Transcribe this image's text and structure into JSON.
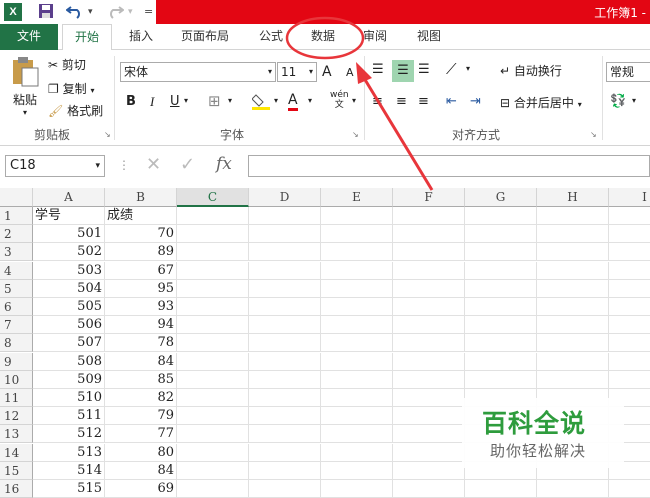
{
  "titlebar": {
    "app_icon": "X",
    "window_title": "工作簿1 -"
  },
  "tabs": [
    {
      "label": "文件"
    },
    {
      "label": "开始"
    },
    {
      "label": "插入"
    },
    {
      "label": "页面布局"
    },
    {
      "label": "公式"
    },
    {
      "label": "数据"
    },
    {
      "label": "审阅"
    },
    {
      "label": "视图"
    }
  ],
  "ribbon": {
    "clipboard": {
      "paste": "粘贴",
      "cut": "剪切",
      "copy": "复制",
      "format_painter": "格式刷",
      "group_label": "剪贴板"
    },
    "font": {
      "font_name": "宋体",
      "font_size": "11",
      "grow": "A",
      "shrink": "A",
      "bold": "B",
      "italic": "I",
      "underline": "U",
      "font_color_glyph": "A",
      "phonetic": "wén",
      "phonetic_sub": "文",
      "group_label": "字体"
    },
    "alignment": {
      "wrap_text": "自动换行",
      "merge_center": "合并后居中",
      "group_label": "对齐方式"
    },
    "number": {
      "format": "常规"
    }
  },
  "formula_bar": {
    "name_box": "C18",
    "cancel": "✕",
    "enter": "✓",
    "fx": "fx",
    "value": ""
  },
  "grid": {
    "columns": [
      "A",
      "B",
      "C",
      "D",
      "E",
      "F",
      "G",
      "H",
      "I"
    ],
    "rows": [
      {
        "n": "1",
        "a": "学号",
        "b": "成绩"
      },
      {
        "n": "2",
        "a": "501",
        "b": "70"
      },
      {
        "n": "3",
        "a": "502",
        "b": "89"
      },
      {
        "n": "4",
        "a": "503",
        "b": "67"
      },
      {
        "n": "5",
        "a": "504",
        "b": "95"
      },
      {
        "n": "6",
        "a": "505",
        "b": "93"
      },
      {
        "n": "7",
        "a": "506",
        "b": "94"
      },
      {
        "n": "8",
        "a": "507",
        "b": "78"
      },
      {
        "n": "9",
        "a": "508",
        "b": "84"
      },
      {
        "n": "10",
        "a": "509",
        "b": "85"
      },
      {
        "n": "11",
        "a": "510",
        "b": "82"
      },
      {
        "n": "12",
        "a": "511",
        "b": "79"
      },
      {
        "n": "13",
        "a": "512",
        "b": "77"
      },
      {
        "n": "14",
        "a": "513",
        "b": "80"
      },
      {
        "n": "15",
        "a": "514",
        "b": "84"
      },
      {
        "n": "16",
        "a": "515",
        "b": "69"
      }
    ]
  },
  "watermark": {
    "title": "百科全说",
    "subtitle": "助你轻松解决"
  },
  "colors": {
    "excel_green": "#217346",
    "title_red": "#e30613",
    "annotation_red": "#e8363b",
    "watermark_green": "#2e9c3d"
  }
}
